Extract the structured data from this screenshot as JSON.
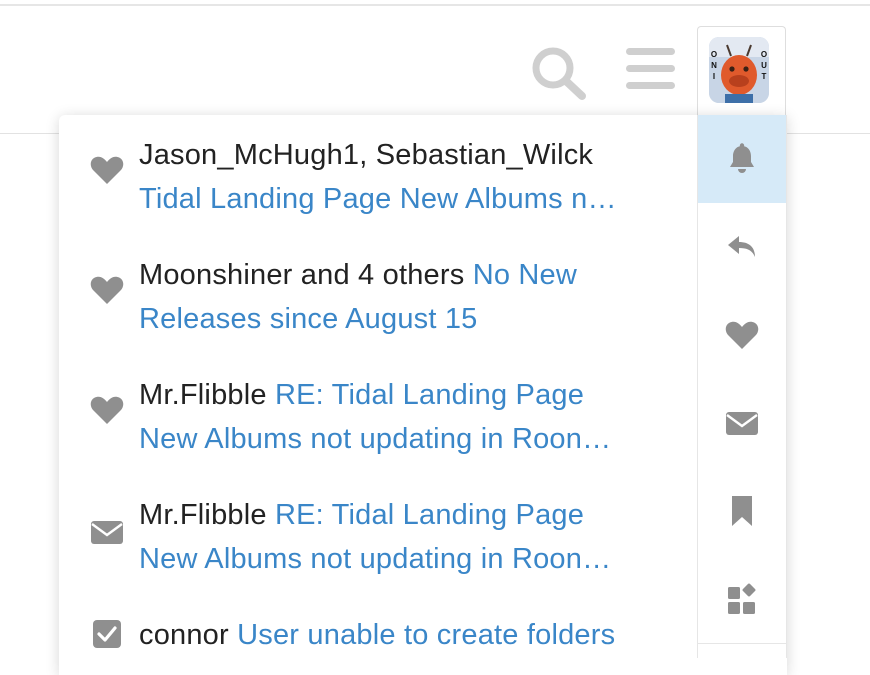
{
  "colors": {
    "link": "#3a86c8",
    "text": "#222222",
    "icon": "#8f8f8f",
    "active_tab_bg": "#d6eaf8",
    "active_tab_icon": "#8f8f8f"
  },
  "header": {
    "search_icon": "search-icon",
    "menu_icon": "hamburger-menu-icon",
    "avatar": {
      "left_letters": "O N I",
      "right_letters": "O U T"
    }
  },
  "notifications": [
    {
      "icon": "heart-icon",
      "actor": "Jason_McHugh1, Sebastian_Wilck",
      "line2": "Tidal Landing Page New Albums n…"
    },
    {
      "icon": "heart-icon",
      "actor": "Moonshiner and 4 others",
      "title_part1": "No New",
      "line2": "Releases since August 15"
    },
    {
      "icon": "heart-icon",
      "actor": "Mr.Flibble",
      "title_part1": "RE: Tidal Landing Page",
      "line2": "New Albums not updating in Roon…"
    },
    {
      "icon": "envelope-icon",
      "actor": "Mr.Flibble",
      "title_part1": "RE: Tidal Landing Page",
      "line2": "New Albums not updating in Roon…"
    },
    {
      "icon": "checkbox-icon",
      "actor": "connor",
      "title_part1": "User unable to create folders"
    }
  ],
  "tabs": [
    {
      "name": "notifications",
      "icon": "bell-icon",
      "active": true
    },
    {
      "name": "replies",
      "icon": "reply-icon",
      "active": false
    },
    {
      "name": "likes",
      "icon": "heart-icon",
      "active": false
    },
    {
      "name": "messages",
      "icon": "envelope-icon",
      "active": false
    },
    {
      "name": "bookmarks",
      "icon": "bookmark-icon",
      "active": false
    },
    {
      "name": "preferences",
      "icon": "widgets-icon",
      "active": false
    }
  ]
}
